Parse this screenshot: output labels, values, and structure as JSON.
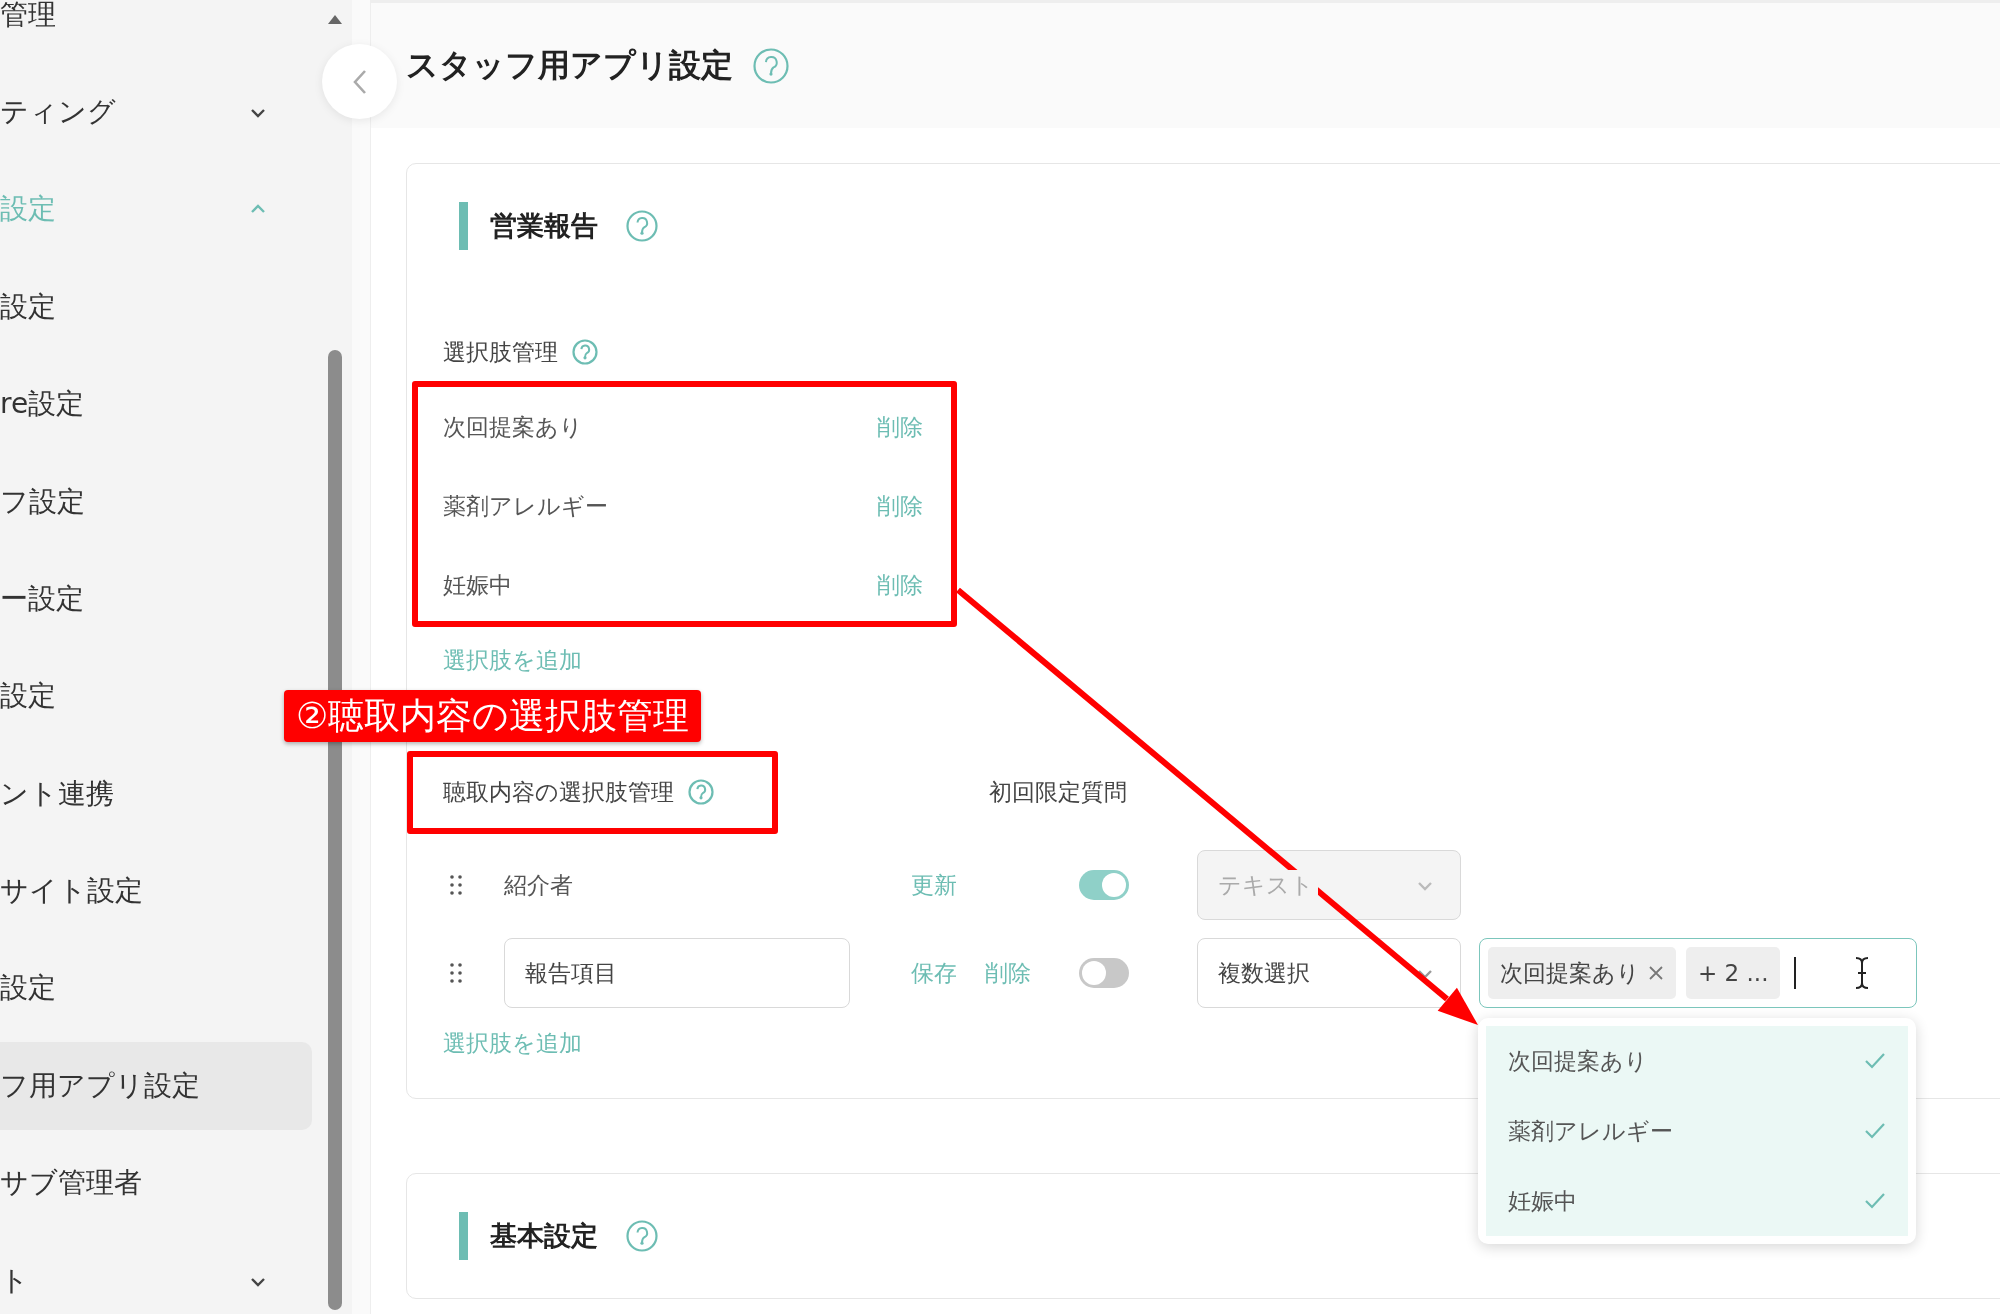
{
  "sidebar": {
    "items": [
      {
        "kind": "link",
        "label": "管理",
        "selected": false
      },
      {
        "kind": "group",
        "label": "ティング",
        "expanded": false
      },
      {
        "kind": "group",
        "label": "設定",
        "expanded": true
      },
      {
        "kind": "link",
        "label": "設定",
        "selected": false
      },
      {
        "kind": "link",
        "label": "re設定",
        "selected": false
      },
      {
        "kind": "link",
        "label": "フ設定",
        "selected": false
      },
      {
        "kind": "link",
        "label": "ー設定",
        "selected": false
      },
      {
        "kind": "link",
        "label": "設定",
        "selected": false
      },
      {
        "kind": "link",
        "label": "ント連携",
        "selected": false
      },
      {
        "kind": "link",
        "label": "サイト設定",
        "selected": false
      },
      {
        "kind": "link",
        "label": "設定",
        "selected": false
      },
      {
        "kind": "link",
        "label": "フ用アプリ設定",
        "selected": true
      },
      {
        "kind": "link",
        "label": "サブ管理者",
        "selected": false
      },
      {
        "kind": "group",
        "label": "ト",
        "expanded": false
      }
    ]
  },
  "header": {
    "title": "スタッフ用アプリ設定"
  },
  "sections": [
    {
      "title": "営業報告",
      "choices": {
        "label": "選択肢管理",
        "options": [
          {
            "label": "次回提案あり",
            "action": "削除"
          },
          {
            "label": "薬剤アレルギー",
            "action": "削除"
          },
          {
            "label": "妊娠中",
            "action": "削除"
          }
        ],
        "add": "選択肢を追加"
      },
      "hearing": {
        "label": "聴取内容の選択肢管理",
        "first_only_label": "初回限定質問",
        "rows": [
          {
            "kind": "static",
            "name": "紹介者",
            "actions": [
              "更新"
            ],
            "first_only": true,
            "type": {
              "value": "テキスト",
              "disabled": true
            }
          },
          {
            "kind": "editing",
            "name": "報告項目",
            "actions": [
              "保存",
              "削除"
            ],
            "first_only": false,
            "type": {
              "value": "複数選択",
              "disabled": false
            },
            "choices": {
              "tags": [
                "次回提案あり"
              ],
              "more": "+ 2 ...",
              "dropdown": [
                {
                  "label": "次回提案あり",
                  "selected": true
                },
                {
                  "label": "薬剤アレルギー",
                  "selected": true
                },
                {
                  "label": "妊娠中",
                  "selected": true
                }
              ]
            }
          }
        ],
        "add": "選択肢を追加"
      }
    },
    {
      "title": "基本設定"
    }
  ],
  "annotation": {
    "label": "②聴取内容の選択肢管理"
  }
}
